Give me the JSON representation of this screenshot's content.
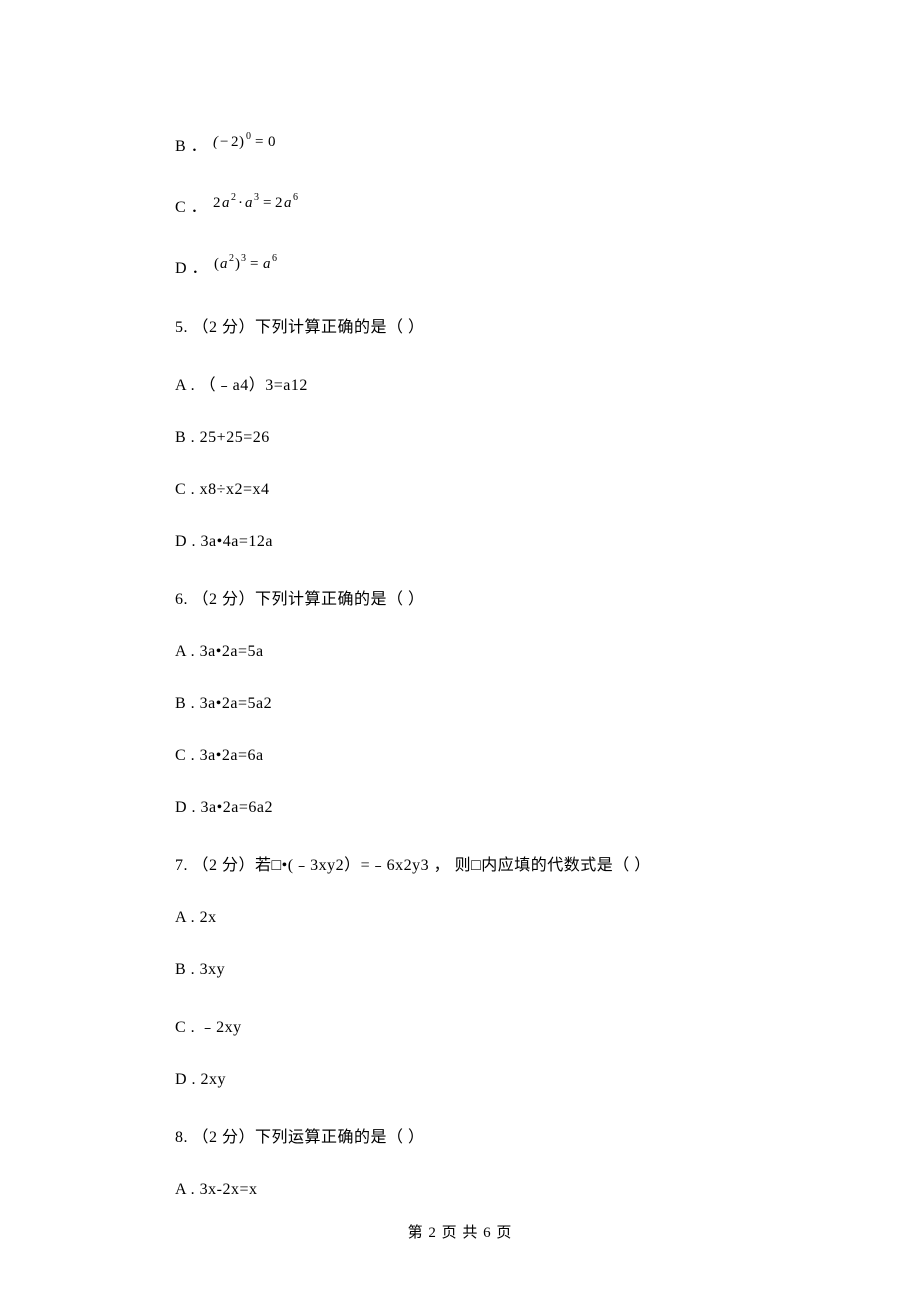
{
  "optB_prefix": "B ．",
  "optC_prefix": "C ．",
  "optD_prefix": "D ．",
  "q5": {
    "stem": "5. （2 分）下列计算正确的是（    ）",
    "a": "A . （﹣a4）3=a12",
    "b": "B . 25+25=26",
    "c": "C . x8÷x2=x4",
    "d": "D . 3a•4a=12a"
  },
  "q6": {
    "stem": "6. （2 分）下列计算正确的是（    ）",
    "a": "A . 3a•2a=5a",
    "b": "B . 3a•2a=5a2",
    "c": "C . 3a•2a=6a",
    "d": "D . 3a•2a=6a2"
  },
  "q7": {
    "stem": "7. （2 分）若□•(﹣3xy2）=﹣6x2y3 ， 则□内应填的代数式是（    ）",
    "a": "A . 2x",
    "b": "B . 3xy",
    "c": "C . ﹣2xy",
    "d": "D . 2xy"
  },
  "q8": {
    "stem": "8. （2 分）下列运算正确的是（    ）",
    "a": "A . 3x-2x=x"
  },
  "footer": "第 2 页 共 6 页"
}
